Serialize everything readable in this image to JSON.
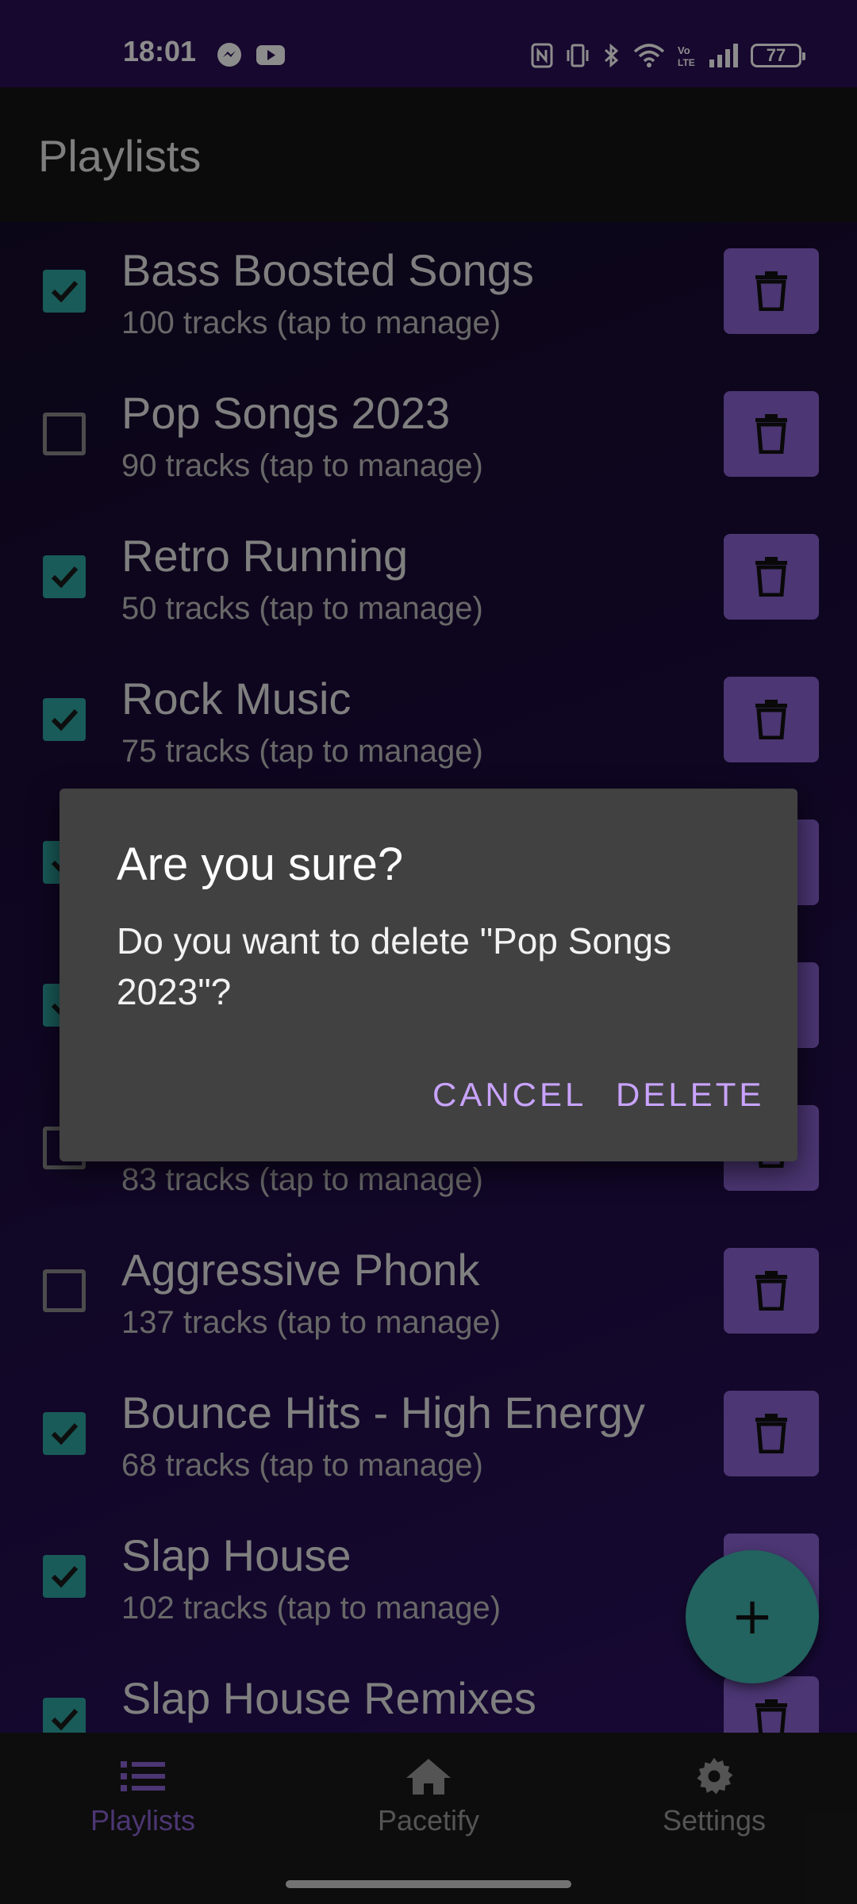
{
  "status_bar": {
    "time": "18:01",
    "battery": "77",
    "left_icons": [
      "messenger-icon",
      "youtube-icon"
    ],
    "right_icons": [
      "nfc-icon",
      "vibrate-icon",
      "bluetooth-icon",
      "wifi-icon",
      "volte-icon",
      "signal-icon",
      "battery-icon"
    ]
  },
  "app_bar": {
    "title": "Playlists"
  },
  "playlists": [
    {
      "title": "Bass Boosted Songs",
      "subtitle": "100 tracks (tap to manage)",
      "checked": true
    },
    {
      "title": "Pop Songs 2023",
      "subtitle": "90 tracks (tap to manage)",
      "checked": false
    },
    {
      "title": "Retro Running",
      "subtitle": "50 tracks (tap to manage)",
      "checked": true
    },
    {
      "title": "Rock Music",
      "subtitle": "75 tracks (tap to manage)",
      "checked": true
    },
    {
      "title": "",
      "subtitle": "",
      "checked": true
    },
    {
      "title": "",
      "subtitle": "",
      "checked": true
    },
    {
      "title": "",
      "subtitle": "83 tracks (tap to manage)",
      "checked": false
    },
    {
      "title": "Aggressive Phonk",
      "subtitle": "137 tracks (tap to manage)",
      "checked": false
    },
    {
      "title": "Bounce Hits - High Energy",
      "subtitle": "68 tracks (tap to manage)",
      "checked": true
    },
    {
      "title": "Slap House",
      "subtitle": "102 tracks (tap to manage)",
      "checked": true
    },
    {
      "title": "Slap House Remixes",
      "subtitle": "",
      "checked": true
    }
  ],
  "fab": {
    "label": "+"
  },
  "bottom_nav": [
    {
      "label": "Playlists",
      "icon": "list-icon",
      "active": true
    },
    {
      "label": "Pacetify",
      "icon": "home-icon",
      "active": false
    },
    {
      "label": "Settings",
      "icon": "gear-icon",
      "active": false
    }
  ],
  "dialog": {
    "title": "Are you sure?",
    "message": "Do you want to delete \"Pop Songs 2023\"?",
    "cancel_label": "CANCEL",
    "delete_label": "DELETE"
  },
  "colors": {
    "accent": "#8a63d2",
    "checkbox": "#2fa7a2",
    "fab": "#3fb2ad",
    "dialog_button": "#c9a3ff",
    "status_bar": "#2a0f57",
    "nav_active": "#8a63d2",
    "nav_inactive": "#9a9a9a"
  }
}
